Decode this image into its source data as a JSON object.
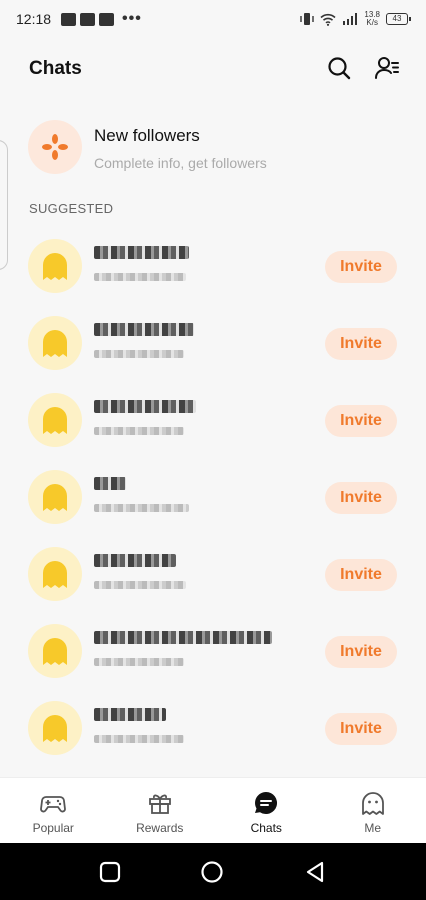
{
  "status_bar": {
    "time": "12:18",
    "network_speed_value": "13.8",
    "network_speed_unit": "K/s",
    "battery": "43"
  },
  "header": {
    "title": "Chats",
    "search_icon": "search-icon",
    "contacts_icon": "contacts-menu-icon"
  },
  "new_followers": {
    "title": "New followers",
    "subtitle": "Complete info, get followers",
    "icon": "pinwheel-icon",
    "accent": "#f07a2c"
  },
  "suggested": {
    "label": "SUGGESTED",
    "items": [
      {
        "invite_label": "Invite"
      },
      {
        "invite_label": "Invite"
      },
      {
        "invite_label": "Invite"
      },
      {
        "invite_label": "Invite"
      },
      {
        "invite_label": "Invite"
      },
      {
        "invite_label": "Invite"
      },
      {
        "invite_label": "Invite"
      }
    ]
  },
  "bottom_nav": {
    "items": [
      {
        "label": "Popular",
        "icon": "gamepad-icon",
        "active": false
      },
      {
        "label": "Rewards",
        "icon": "gift-icon",
        "active": false
      },
      {
        "label": "Chats",
        "icon": "chat-icon",
        "active": true
      },
      {
        "label": "Me",
        "icon": "ghost-icon",
        "active": false
      }
    ]
  },
  "colors": {
    "invite_text": "#f07a2c",
    "invite_bg": "#fde6d8",
    "avatar_bg": "#fdf1c6",
    "ghost": "#f7c92a"
  }
}
